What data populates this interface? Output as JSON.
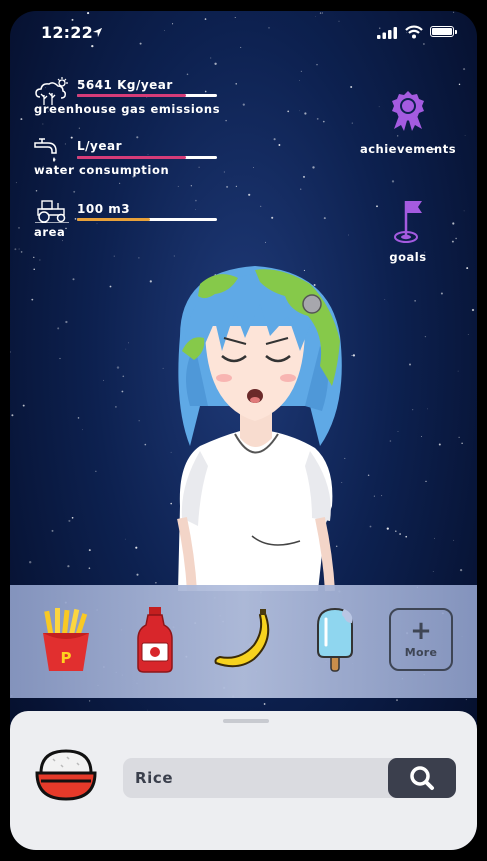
{
  "status_bar": {
    "time": "12:22"
  },
  "stats": [
    {
      "value": "5641 Kg/year",
      "label": "greenhouse gas emissions",
      "icon": "weather-icon",
      "level": 0.78,
      "color": "#d63c78"
    },
    {
      "value": "L/year",
      "label": "water consumption",
      "icon": "faucet-icon",
      "level": 0.78,
      "color": "#d63c78"
    },
    {
      "value": "100 m3",
      "label": "area",
      "icon": "tractor-icon",
      "level": 0.52,
      "color": "#e8a13a"
    }
  ],
  "side": {
    "achievements": {
      "label": "achievements",
      "icon": "award-medal-icon",
      "color": "#a45be0"
    },
    "goals": {
      "label": "goals",
      "icon": "flag-goal-icon",
      "color": "#a45be0"
    }
  },
  "foods": [
    {
      "name": "fries-icon"
    },
    {
      "name": "ketchup-icon"
    },
    {
      "name": "banana-icon"
    },
    {
      "name": "popsicle-icon"
    }
  ],
  "more": {
    "label": "More"
  },
  "search": {
    "value": "Rice",
    "icon": "search-icon"
  },
  "selected_food": {
    "icon": "rice-bowl-icon"
  }
}
